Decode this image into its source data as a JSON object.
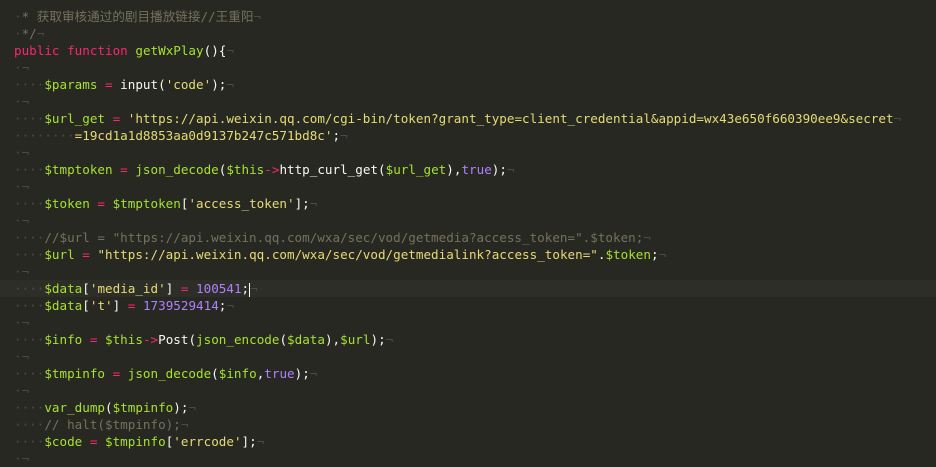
{
  "editor": {
    "lines": [
      {
        "indent": 1,
        "tokens": [
          {
            "t": "* 获取审核通过的剧目播放链接//王重阳",
            "c": "t-comment"
          }
        ]
      },
      {
        "indent": 1,
        "tokens": [
          {
            "t": "*/",
            "c": "t-comment"
          }
        ]
      },
      {
        "indent": 0,
        "tokens": [
          {
            "t": "public",
            "c": "t-kw"
          },
          {
            "t": " ",
            "c": "t-plain"
          },
          {
            "t": "function",
            "c": "t-kw"
          },
          {
            "t": " ",
            "c": "t-plain"
          },
          {
            "t": "getWxPlay",
            "c": "t-fn"
          },
          {
            "t": "(){",
            "c": "t-plain"
          }
        ]
      },
      {
        "indent": 0,
        "tokens": []
      },
      {
        "indent": 4,
        "tokens": [
          {
            "t": "$params",
            "c": "t-var"
          },
          {
            "t": " = ",
            "c": "t-op"
          },
          {
            "t": "input",
            "c": "t-plain"
          },
          {
            "t": "(",
            "c": "t-plain"
          },
          {
            "t": "'code'",
            "c": "t-str"
          },
          {
            "t": ");",
            "c": "t-plain"
          }
        ]
      },
      {
        "indent": 0,
        "tokens": []
      },
      {
        "indent": 4,
        "tokens": [
          {
            "t": "$url_get",
            "c": "t-var"
          },
          {
            "t": " = ",
            "c": "t-op"
          },
          {
            "t": "'https://api.weixin.qq.com/cgi-bin/token?grant_type=client_credential&appid=wx43e650f660390ee9&secret",
            "c": "t-str"
          }
        ]
      },
      {
        "indent": 8,
        "tokens": [
          {
            "t": "=19cd1a1d8853aa0d9137b247c571bd8c'",
            "c": "t-str"
          },
          {
            "t": ";",
            "c": "t-plain"
          }
        ]
      },
      {
        "indent": 0,
        "tokens": []
      },
      {
        "indent": 4,
        "tokens": [
          {
            "t": "$tmptoken",
            "c": "t-var"
          },
          {
            "t": " = ",
            "c": "t-op"
          },
          {
            "t": "json_decode",
            "c": "t-cn"
          },
          {
            "t": "(",
            "c": "t-plain"
          },
          {
            "t": "$this",
            "c": "t-var"
          },
          {
            "t": "->",
            "c": "t-arrow"
          },
          {
            "t": "http_curl_get",
            "c": "t-plain"
          },
          {
            "t": "(",
            "c": "t-plain"
          },
          {
            "t": "$url_get",
            "c": "t-var"
          },
          {
            "t": "),",
            "c": "t-plain"
          },
          {
            "t": "true",
            "c": "t-bool"
          },
          {
            "t": ");",
            "c": "t-plain"
          }
        ]
      },
      {
        "indent": 0,
        "tokens": []
      },
      {
        "indent": 4,
        "tokens": [
          {
            "t": "$token",
            "c": "t-var"
          },
          {
            "t": " = ",
            "c": "t-op"
          },
          {
            "t": "$tmptoken",
            "c": "t-var"
          },
          {
            "t": "[",
            "c": "t-plain"
          },
          {
            "t": "'access_token'",
            "c": "t-str"
          },
          {
            "t": "];",
            "c": "t-plain"
          }
        ]
      },
      {
        "indent": 0,
        "tokens": []
      },
      {
        "indent": 4,
        "tokens": [
          {
            "t": "//$url = \"https://api.weixin.qq.com/wxa/sec/vod/getmedia?access_token=\".$token;",
            "c": "t-comment"
          }
        ]
      },
      {
        "indent": 4,
        "tokens": [
          {
            "t": "$url",
            "c": "t-var"
          },
          {
            "t": " = ",
            "c": "t-op"
          },
          {
            "t": "\"https://api.weixin.qq.com/wxa/sec/vod/getmedialink?access_token=\"",
            "c": "t-str"
          },
          {
            "t": ".",
            "c": "t-plain"
          },
          {
            "t": "$token",
            "c": "t-var"
          },
          {
            "t": ";",
            "c": "t-plain"
          }
        ]
      },
      {
        "indent": 0,
        "tokens": []
      },
      {
        "indent": 4,
        "current": true,
        "caret": true,
        "tokens": [
          {
            "t": "$data",
            "c": "t-var"
          },
          {
            "t": "[",
            "c": "t-plain"
          },
          {
            "t": "'media_id'",
            "c": "t-str"
          },
          {
            "t": "]",
            "c": "t-plain"
          },
          {
            "t": " = ",
            "c": "t-op"
          },
          {
            "t": "100541",
            "c": "t-num"
          },
          {
            "t": ";",
            "c": "t-plain"
          }
        ]
      },
      {
        "indent": 4,
        "tokens": [
          {
            "t": "$data",
            "c": "t-var"
          },
          {
            "t": "[",
            "c": "t-plain"
          },
          {
            "t": "'t'",
            "c": "t-str"
          },
          {
            "t": "]",
            "c": "t-plain"
          },
          {
            "t": " = ",
            "c": "t-op"
          },
          {
            "t": "1739529414",
            "c": "t-num"
          },
          {
            "t": ";",
            "c": "t-plain"
          }
        ]
      },
      {
        "indent": 0,
        "tokens": []
      },
      {
        "indent": 4,
        "tokens": [
          {
            "t": "$info",
            "c": "t-var"
          },
          {
            "t": " = ",
            "c": "t-op"
          },
          {
            "t": "$this",
            "c": "t-var"
          },
          {
            "t": "->",
            "c": "t-arrow"
          },
          {
            "t": "Post",
            "c": "t-plain"
          },
          {
            "t": "(",
            "c": "t-plain"
          },
          {
            "t": "json_encode",
            "c": "t-cn"
          },
          {
            "t": "(",
            "c": "t-plain"
          },
          {
            "t": "$data",
            "c": "t-var"
          },
          {
            "t": "),",
            "c": "t-plain"
          },
          {
            "t": "$url",
            "c": "t-var"
          },
          {
            "t": ");",
            "c": "t-plain"
          }
        ]
      },
      {
        "indent": 0,
        "tokens": []
      },
      {
        "indent": 4,
        "tokens": [
          {
            "t": "$tmpinfo",
            "c": "t-var"
          },
          {
            "t": " = ",
            "c": "t-op"
          },
          {
            "t": "json_decode",
            "c": "t-cn"
          },
          {
            "t": "(",
            "c": "t-plain"
          },
          {
            "t": "$info",
            "c": "t-var"
          },
          {
            "t": ",",
            "c": "t-plain"
          },
          {
            "t": "true",
            "c": "t-bool"
          },
          {
            "t": ");",
            "c": "t-plain"
          }
        ]
      },
      {
        "indent": 0,
        "tokens": []
      },
      {
        "indent": 4,
        "tokens": [
          {
            "t": "var_dump",
            "c": "t-cn"
          },
          {
            "t": "(",
            "c": "t-plain"
          },
          {
            "t": "$tmpinfo",
            "c": "t-var"
          },
          {
            "t": ");",
            "c": "t-plain"
          }
        ]
      },
      {
        "indent": 4,
        "tokens": [
          {
            "t": "// halt($tmpinfo);",
            "c": "t-comment"
          }
        ]
      },
      {
        "indent": 4,
        "tokens": [
          {
            "t": "$code",
            "c": "t-var"
          },
          {
            "t": " = ",
            "c": "t-op"
          },
          {
            "t": "$tmpinfo",
            "c": "t-var"
          },
          {
            "t": "[",
            "c": "t-plain"
          },
          {
            "t": "'errcode'",
            "c": "t-str"
          },
          {
            "t": "];",
            "c": "t-plain"
          }
        ]
      },
      {
        "indent": 0,
        "tokens": []
      }
    ],
    "eol_marker": "¬"
  }
}
